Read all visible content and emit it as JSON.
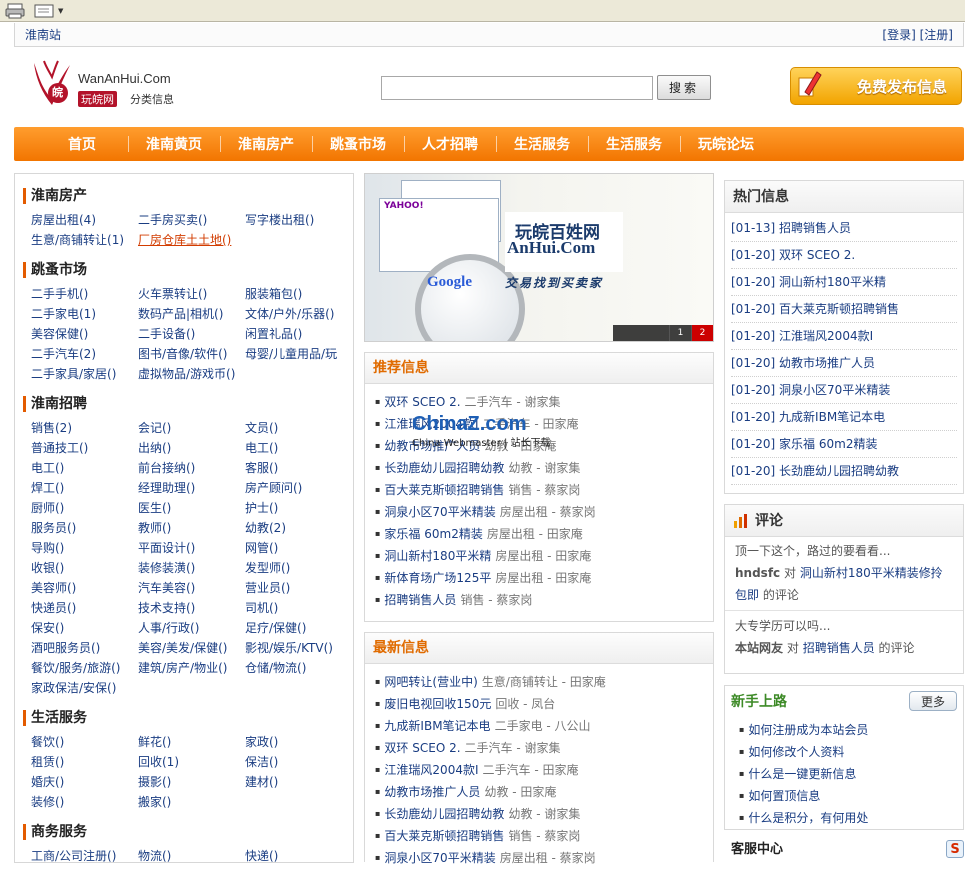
{
  "toolbar": {
    "icons": [
      "print-icon",
      "edit-icon"
    ]
  },
  "topbar": {
    "site_name": "淮南站",
    "login": "[登录]",
    "register": "[注册]"
  },
  "logo": {
    "domain": "WanAnHui.Com",
    "badge": "玩皖网",
    "subtitle": "分类信息"
  },
  "search": {
    "placeholder": "",
    "value": "",
    "button": "搜索"
  },
  "publish_button": "免费发布信息",
  "nav": [
    "首页",
    "淮南黄页",
    "淮南房产",
    "跳蚤市场",
    "人才招聘",
    "生活服务",
    "生活服务",
    "玩皖论坛"
  ],
  "categories": [
    {
      "title": "淮南房产",
      "items": [
        "房屋出租(4)",
        "二手房买卖()",
        "写字楼出租()",
        "生意/商铺转让(1)",
        "厂房仓库土土地()"
      ],
      "highlight": 4
    },
    {
      "title": "跳蚤市场",
      "items": [
        "二手手机()",
        "火车票转让()",
        "服装箱包()",
        "二手家电(1)",
        "数码产品|相机()",
        "文体/户外/乐器()",
        "美容保健()",
        "二手设备()",
        "闲置礼品()",
        "二手汽车(2)",
        "图书/音像/软件()",
        "母婴/儿童用品/玩",
        "二手家具/家居()",
        "虚拟物品/游戏币()"
      ]
    },
    {
      "title": "淮南招聘",
      "items": [
        "销售(2)",
        "会记()",
        "文员()",
        "普通技工()",
        "出纳()",
        "电工()",
        "电工()",
        "前台接纳()",
        "客服()",
        "焊工()",
        "经理助理()",
        "房产顾问()",
        "厨师()",
        "医生()",
        "护士()",
        "服务员()",
        "教师()",
        "幼教(2)",
        "导购()",
        "平面设计()",
        "网管()",
        "收银()",
        "装修装潢()",
        "发型师()",
        "美容师()",
        "汽车美容()",
        "营业员()",
        "快递员()",
        "技术支持()",
        "司机()",
        "保安()",
        "人事/行政()",
        "足疗/保健()",
        "酒吧服务员()",
        "美容/美发/保健()",
        "影视/娱乐/KTV()",
        "餐饮/服务/旅游()",
        "建筑/房产/物业()",
        "仓储/物流()",
        "家政保洁/安保()"
      ]
    },
    {
      "title": "生活服务",
      "items": [
        "餐饮()",
        "鲜花()",
        "家政()",
        "租赁()",
        "回收(1)",
        "保洁()",
        "婚庆()",
        "摄影()",
        "建材()",
        "装修()",
        "搬家()"
      ]
    },
    {
      "title": "商务服务",
      "items": [
        "工商/公司注册()",
        "物流()",
        "快递()"
      ]
    }
  ],
  "banner": {
    "brand_line1": "玩皖百姓网",
    "brand_line2": "AnHui.Com",
    "slogan": "交易找到买卖家",
    "google": "Google",
    "yahoo": "YAHOO!",
    "pages": [
      "1",
      "2"
    ]
  },
  "recommended": {
    "title": "推荐信息",
    "items": [
      {
        "title": "双环 SCEO 2.",
        "meta": "二手汽车 - 谢家集"
      },
      {
        "title": "江淮瑞风2004款I",
        "meta": "二手汽车 - 田家庵"
      },
      {
        "title": "幼教市场推广人员",
        "meta": "幼教 - 田家庵"
      },
      {
        "title": "长劲鹿幼儿园招聘幼教",
        "meta": "幼教 - 谢家集"
      },
      {
        "title": "百大莱克斯顿招聘销售",
        "meta": "销售 - 蔡家岗"
      },
      {
        "title": "洞泉小区70平米精装",
        "meta": "房屋出租 - 蔡家岗"
      },
      {
        "title": "家乐福 60m2精装",
        "meta": "房屋出租 - 田家庵"
      },
      {
        "title": "洞山新村180平米精",
        "meta": "房屋出租 - 田家庵"
      },
      {
        "title": "新体育场广场125平",
        "meta": "房屋出租 - 田家庵"
      },
      {
        "title": "招聘销售人员",
        "meta": "销售 - 蔡家岗"
      }
    ]
  },
  "latest": {
    "title": "最新信息",
    "items": [
      {
        "title": "网吧转让(营业中)",
        "meta": "生意/商铺转让 - 田家庵"
      },
      {
        "title": "废旧电视回收150元",
        "meta": "回收 - 凤台"
      },
      {
        "title": "九成新IBM笔记本电",
        "meta": "二手家电 - 八公山"
      },
      {
        "title": "双环 SCEO 2.",
        "meta": "二手汽车 - 谢家集"
      },
      {
        "title": "江淮瑞风2004款I",
        "meta": "二手汽车 - 田家庵"
      },
      {
        "title": "幼教市场推广人员",
        "meta": "幼教 - 田家庵"
      },
      {
        "title": "长劲鹿幼儿园招聘幼教",
        "meta": "幼教 - 谢家集"
      },
      {
        "title": "百大莱克斯顿招聘销售",
        "meta": "销售 - 蔡家岗"
      },
      {
        "title": "洞泉小区70平米精装",
        "meta": "房屋出租 - 蔡家岗"
      }
    ]
  },
  "watermark": {
    "logo": "ChinaZ.com",
    "tagline": "China Webmaster | 站长下载"
  },
  "hot": {
    "title": "热门信息",
    "items": [
      "[01-13] 招聘销售人员",
      "[01-20] 双环 SCEO 2.",
      "[01-20] 洞山新村180平米精",
      "[01-20] 百大莱克斯顿招聘销售",
      "[01-20] 江淮瑞风2004款I",
      "[01-20] 幼教市场推广人员",
      "[01-20] 洞泉小区70平米精装",
      "[01-20] 九成新IBM笔记本电",
      "[01-20] 家乐福 60m2精装",
      "[01-20] 长劲鹿幼儿园招聘幼教"
    ]
  },
  "comments": {
    "title": "评论",
    "items": [
      {
        "text": "顶一下这个，路过的要看看...",
        "user": "hndsfc",
        "on": "对",
        "link": "洞山新村180平米精装修拎包即",
        "suffix": "的评论"
      },
      {
        "text": "大专学历可以吗...",
        "user": "本站网友",
        "on": "对",
        "link": "招聘销售人员",
        "suffix": "的评论"
      }
    ]
  },
  "newbie": {
    "title": "新手上路",
    "more": "更多",
    "items": [
      "如何注册成为本站会员",
      "如何修改个人资料",
      "什么是一键更新信息",
      "如何置顶信息",
      "什么是积分，有何用处"
    ]
  },
  "service": {
    "title": "客服中心",
    "icon_letter": "S"
  },
  "colors": {
    "nav": "#f27500",
    "accent": "#e06b00",
    "link": "#1a3d82",
    "newbie": "#3d8a27"
  }
}
